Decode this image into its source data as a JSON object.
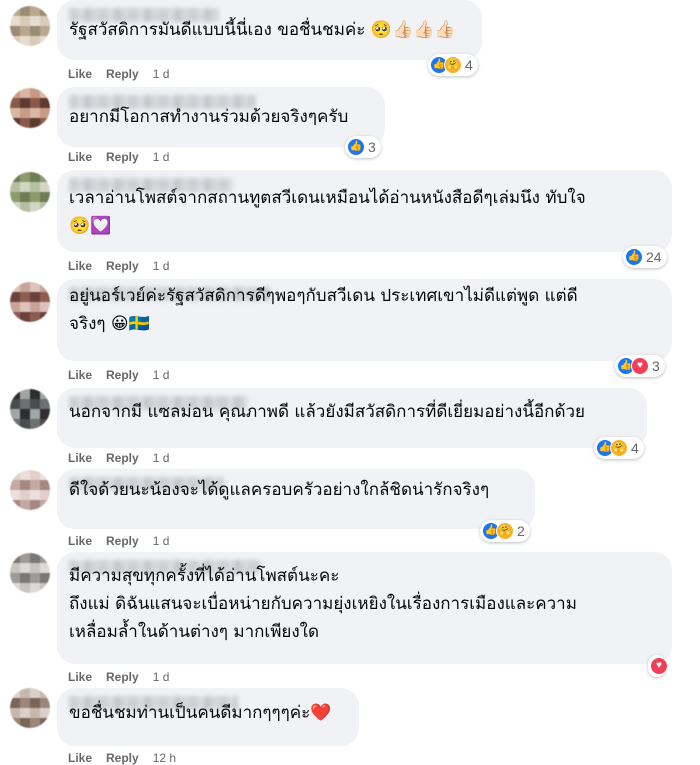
{
  "comments": [
    {
      "text_lines": [
        "รัฐสวัสดิการมันดีแบบนี้นี่เอง ขอชื่นชมค่ะ 🥺👍🏻👍🏻👍🏻"
      ],
      "like": "Like",
      "reply": "Reply",
      "time": "1 d",
      "reactions": [
        "like",
        "care"
      ],
      "count": "4"
    },
    {
      "text_lines": [
        "อยากมีโอกาสทำงานร่วมด้วยจริงๆครับ"
      ],
      "like": "Like",
      "reply": "Reply",
      "time": "1 d",
      "reactions": [
        "like"
      ],
      "count": "3"
    },
    {
      "text_lines": [
        "เวลาอ่านโพสต์จากสถานทูตสวีเดนเหมือนได้อ่านหนังสือดีๆเล่มนึง ทับใจ",
        "🥺💟"
      ],
      "like": "Like",
      "reply": "Reply",
      "time": "1 d",
      "reactions": [
        "like"
      ],
      "count": "24"
    },
    {
      "text_lines": [
        "อยู่นอร์เวย์ค่ะรัฐสวัสดิการดีๆพอๆกับสวีเดน ประเทศเขาไม่ดีแต่พูด แต่ดี",
        "จริงๆ 😀🇸🇪"
      ],
      "like": "Like",
      "reply": "Reply",
      "time": "1 d",
      "reactions": [
        "like",
        "love"
      ],
      "count": "3"
    },
    {
      "text_lines": [
        "นอกจากมี แซลม่อน คุณภาพดี แล้วยังมีสวัสดิการที่ดีเยี่ยมอย่างนี้อีกด้วย"
      ],
      "like": "Like",
      "reply": "Reply",
      "time": "1 d",
      "reactions": [
        "like",
        "care"
      ],
      "count": "4"
    },
    {
      "text_lines": [
        "ดีใจด้วยนะน้องจะได้ดูแลครอบครัวอย่างใกล้ชิดน่ารักจริงๆ"
      ],
      "like": "Like",
      "reply": "Reply",
      "time": "1 d",
      "reactions": [
        "like",
        "care"
      ],
      "count": "2"
    },
    {
      "text_lines": [
        "มีความสุขทุกครั้งที่ได้อ่านโพสต์นะคะ",
        "ถึงแม่ ดิฉันแสนจะเบื่อหน่ายกับความยุ่งเหยิงในเรื่องการเมืองและความ",
        "เหลื่อมล้ำในด้านต่างๆ มากเพียงใด"
      ],
      "like": "Like",
      "reply": "Reply",
      "time": "1 d",
      "reactions": [
        "love"
      ],
      "count": ""
    },
    {
      "text_lines": [
        "ขอชื่นชมท่านเป็นคนดีมากๆๆๆค่ะ❤️"
      ],
      "like": "Like",
      "reply": "Reply",
      "time": "12 h",
      "reactions": [],
      "count": ""
    }
  ],
  "reaction_colors": {
    "like": "#1877f2",
    "care": "#f7b125",
    "love": "#f33e58"
  },
  "reaction_icons": {
    "like": "thumbs-up-icon",
    "care": "care-hug-icon",
    "love": "heart-icon"
  }
}
